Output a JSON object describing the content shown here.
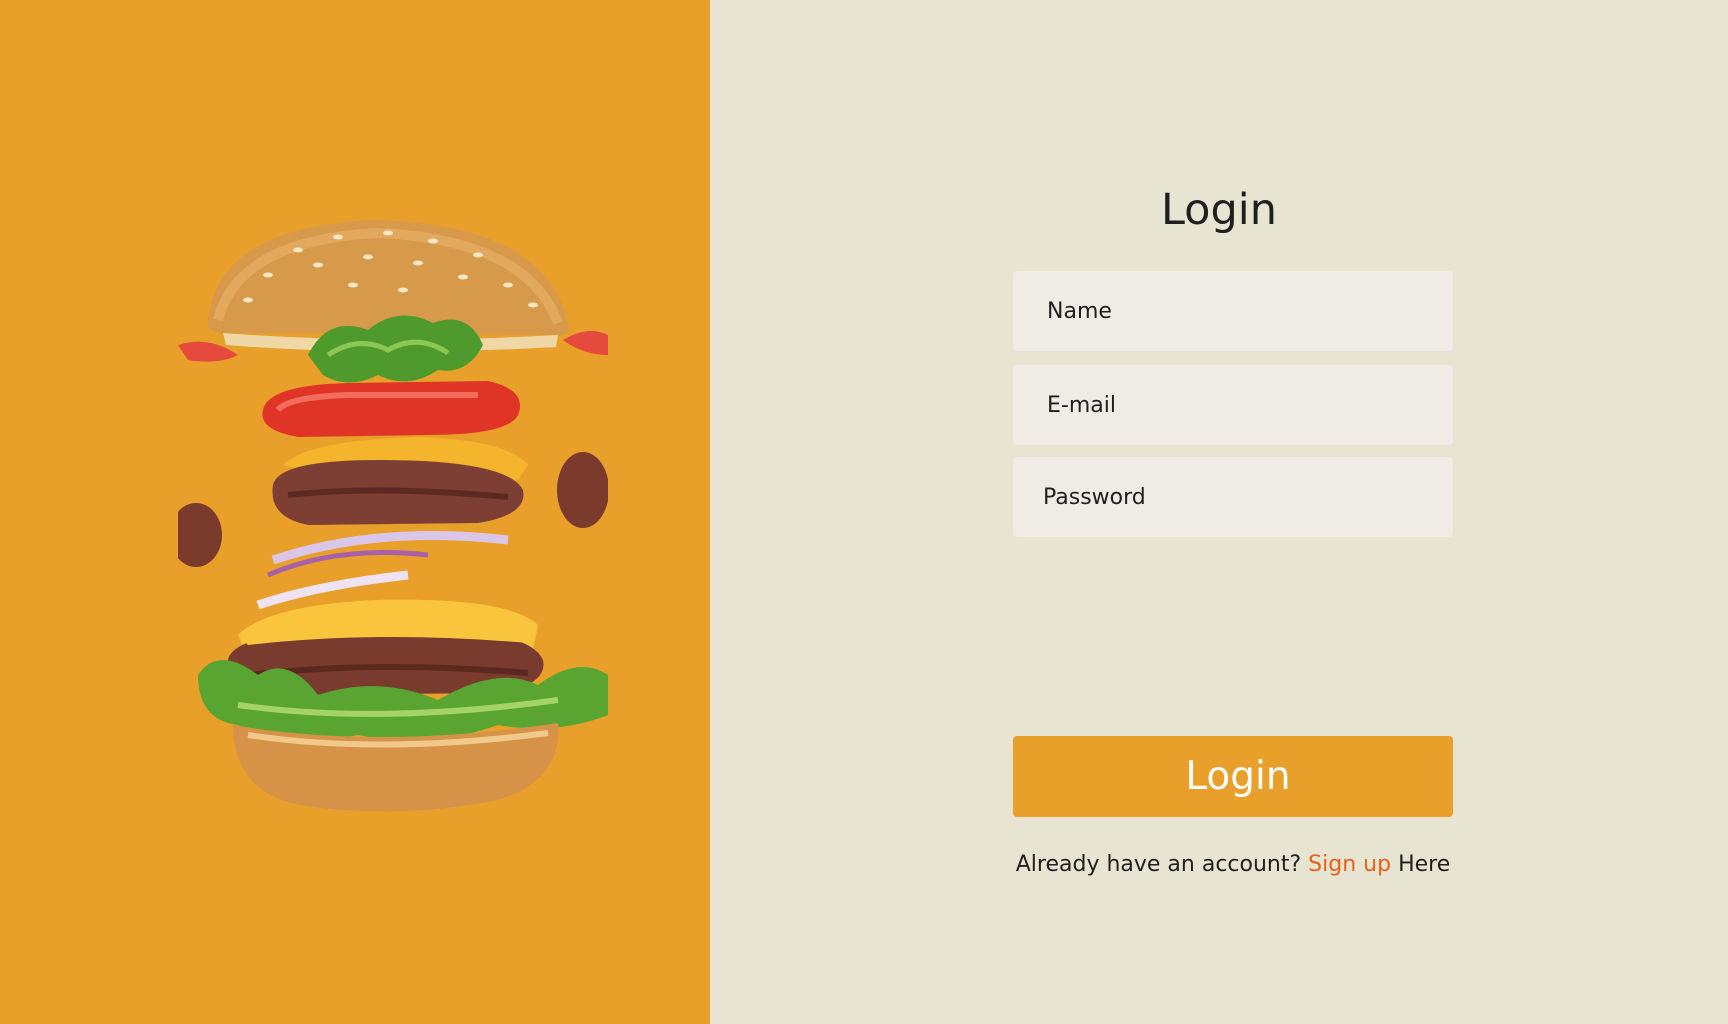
{
  "colors": {
    "brand_orange": "#e8a02a",
    "panel_cream": "#e7e4d2",
    "field_bg": "#efebe5",
    "link_orange": "#e8611a",
    "text_dark": "#1f1f1f"
  },
  "hero": {
    "image_name": "burger-image",
    "alt": "Stacked cheeseburger"
  },
  "login": {
    "title": "Login",
    "name_placeholder": "Name",
    "email_placeholder": "E-mail",
    "password_placeholder": "Password",
    "button_label": "Login"
  },
  "footer": {
    "prompt": "Already have an account?",
    "link_label": "Sign up",
    "suffix": "Here"
  }
}
